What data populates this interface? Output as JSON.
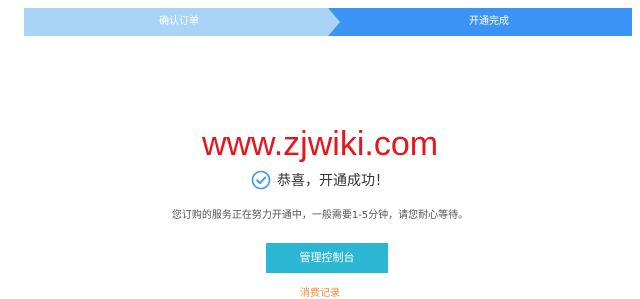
{
  "steps": {
    "step1_label": "确认订单",
    "step2_label": "开通完成",
    "step1_color": "#a9d3f7",
    "step2_color": "#3a93f5"
  },
  "watermark": "www.zjwiki.com",
  "success": {
    "icon": "check-circle-icon",
    "message": "恭喜，开通成功！"
  },
  "info": "您订购的服务正在努力开通中，一般需要1-5分钟，请您耐心等待。",
  "actions": {
    "console_label": "管理控制台",
    "records_label": "消费记录"
  }
}
